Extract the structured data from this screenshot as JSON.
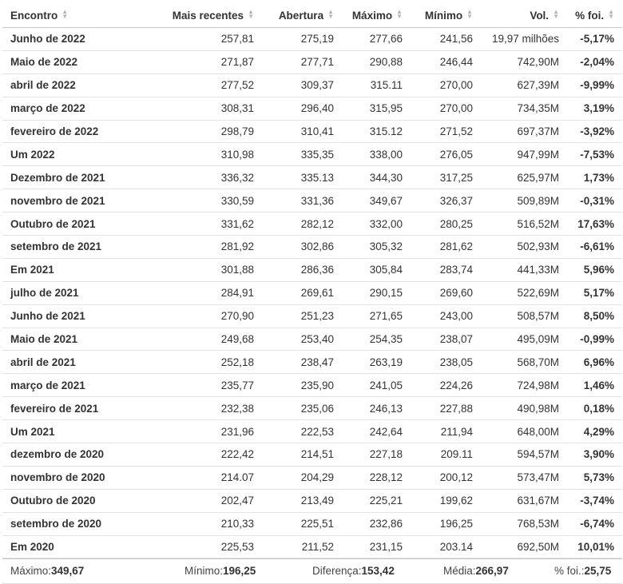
{
  "headers": [
    "Encontro",
    "Mais recentes",
    "Abertura",
    "Máximo",
    "Mínimo",
    "Vol.",
    "% foi."
  ],
  "sort_icon": "sort-arrows-icon",
  "colors": {
    "up": "#3c9a1e",
    "down": "#e0111b",
    "header_border": "#c8c8c8",
    "row_border": "#e2e2e2"
  },
  "rows": [
    {
      "date": "Junho de 2022",
      "last": "257,81",
      "open": "275,19",
      "high": "277,66",
      "low": "241,56",
      "vol": "19,97 milhões",
      "chg": "-5,17%"
    },
    {
      "date": "Maio de 2022",
      "last": "271,87",
      "open": "277,71",
      "high": "290,88",
      "low": "246,44",
      "vol": "742,90M",
      "chg": "-2,04%"
    },
    {
      "date": "abril de 2022",
      "last": "277,52",
      "open": "309,37",
      "high": "315.11",
      "low": "270,00",
      "vol": "627,39M",
      "chg": "-9,99%"
    },
    {
      "date": "março de 2022",
      "last": "308,31",
      "open": "296,40",
      "high": "315,95",
      "low": "270,00",
      "vol": "734,35M",
      "chg": "3,19%"
    },
    {
      "date": "fevereiro de 2022",
      "last": "298,79",
      "open": "310,41",
      "high": "315.12",
      "low": "271,52",
      "vol": "697,37M",
      "chg": "-3,92%"
    },
    {
      "date": "Um 2022",
      "last": "310,98",
      "open": "335,35",
      "high": "338,00",
      "low": "276,05",
      "vol": "947,99M",
      "chg": "-7,53%"
    },
    {
      "date": "Dezembro de 2021",
      "last": "336,32",
      "open": "335.13",
      "high": "344,30",
      "low": "317,25",
      "vol": "625,97M",
      "chg": "1,73%"
    },
    {
      "date": "novembro de 2021",
      "last": "330,59",
      "open": "331,36",
      "high": "349,67",
      "low": "326,37",
      "vol": "509,89M",
      "chg": "-0,31%"
    },
    {
      "date": "Outubro de 2021",
      "last": "331,62",
      "open": "282,12",
      "high": "332,00",
      "low": "280,25",
      "vol": "516,52M",
      "chg": "17,63%"
    },
    {
      "date": "setembro de 2021",
      "last": "281,92",
      "open": "302,86",
      "high": "305,32",
      "low": "281,62",
      "vol": "502,93M",
      "chg": "-6,61%"
    },
    {
      "date": "Em 2021",
      "last": "301,88",
      "open": "286,36",
      "high": "305,84",
      "low": "283,74",
      "vol": "441,33M",
      "chg": "5,96%"
    },
    {
      "date": "julho de 2021",
      "last": "284,91",
      "open": "269,61",
      "high": "290,15",
      "low": "269,60",
      "vol": "522,69M",
      "chg": "5,17%"
    },
    {
      "date": "Junho de 2021",
      "last": "270,90",
      "open": "251,23",
      "high": "271,65",
      "low": "243,00",
      "vol": "508,57M",
      "chg": "8,50%"
    },
    {
      "date": "Maio de 2021",
      "last": "249,68",
      "open": "253,40",
      "high": "254,35",
      "low": "238,07",
      "vol": "495,09M",
      "chg": "-0,99%"
    },
    {
      "date": "abril de 2021",
      "last": "252,18",
      "open": "238,47",
      "high": "263,19",
      "low": "238,05",
      "vol": "568,70M",
      "chg": "6,96%"
    },
    {
      "date": "março de 2021",
      "last": "235,77",
      "open": "235,90",
      "high": "241,05",
      "low": "224,26",
      "vol": "724,98M",
      "chg": "1,46%"
    },
    {
      "date": "fevereiro de 2021",
      "last": "232,38",
      "open": "235,06",
      "high": "246,13",
      "low": "227,88",
      "vol": "490,98M",
      "chg": "0,18%"
    },
    {
      "date": "Um 2021",
      "last": "231,96",
      "open": "222,53",
      "high": "242,64",
      "low": "211,94",
      "vol": "648,00M",
      "chg": "4,29%"
    },
    {
      "date": "dezembro de 2020",
      "last": "222,42",
      "open": "214,51",
      "high": "227,18",
      "low": "209.11",
      "vol": "594,57M",
      "chg": "3,90%"
    },
    {
      "date": "novembro de 2020",
      "last": "214.07",
      "open": "204,29",
      "high": "228,12",
      "low": "200,12",
      "vol": "573,47M",
      "chg": "5,73%"
    },
    {
      "date": "Outubro de 2020",
      "last": "202,47",
      "open": "213,49",
      "high": "225,21",
      "low": "199,62",
      "vol": "631,67M",
      "chg": "-3,74%"
    },
    {
      "date": "setembro de 2020",
      "last": "210,33",
      "open": "225,51",
      "high": "232,86",
      "low": "196,25",
      "vol": "768,53M",
      "chg": "-6,74%"
    },
    {
      "date": "Em 2020",
      "last": "225,53",
      "open": "211,52",
      "high": "231,15",
      "low": "203.14",
      "vol": "692,50M",
      "chg": "10,01%"
    }
  ],
  "footer": {
    "max_label": "Máximo:",
    "max_value": "349,67",
    "min_label": "Mínimo:",
    "min_value": "196,25",
    "diff_label": "Diferença:",
    "diff_value": "153,42",
    "avg_label": "Média:",
    "avg_value": "266,97",
    "chg_label": "% foi.:",
    "chg_value": "25,75"
  }
}
